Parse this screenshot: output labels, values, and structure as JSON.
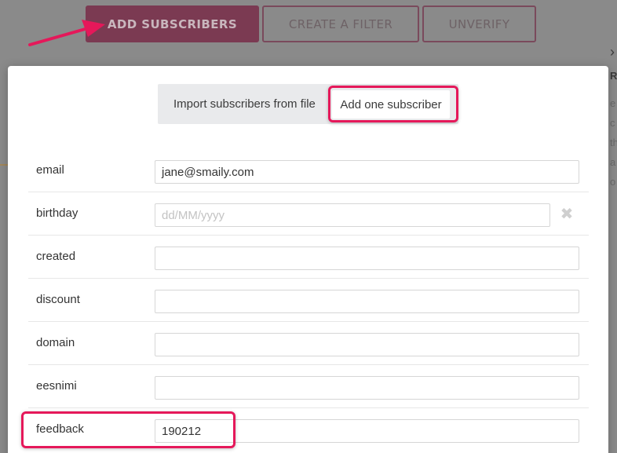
{
  "toolbar": {
    "add_subscribers": "ADD SUBSCRIBERS",
    "create_filter": "CREATE A FILTER",
    "unverify": "UNVERIFY"
  },
  "background": {
    "right_edge_glyphs": [
      "R",
      "e",
      "c",
      "th",
      "a",
      "o"
    ]
  },
  "modal": {
    "tabs": {
      "import": "Import subscribers from file",
      "add_one": "Add one subscriber"
    },
    "fields": [
      {
        "label": "email",
        "value": "jane@smaily.com",
        "placeholder": ""
      },
      {
        "label": "birthday",
        "value": "",
        "placeholder": "dd/MM/yyyy"
      },
      {
        "label": "created",
        "value": "",
        "placeholder": ""
      },
      {
        "label": "discount",
        "value": "",
        "placeholder": ""
      },
      {
        "label": "domain",
        "value": "",
        "placeholder": ""
      },
      {
        "label": "eesnimi",
        "value": "",
        "placeholder": ""
      },
      {
        "label": "feedback",
        "value": "190212",
        "placeholder": ""
      }
    ],
    "clear_icon": "✖"
  },
  "colors": {
    "highlight": "#e5185a",
    "primary_button": "#7b3a52",
    "overlay": "#8a8a8a"
  },
  "icons": {
    "arrow": "annotation-arrow-icon",
    "clear": "clear-icon"
  }
}
